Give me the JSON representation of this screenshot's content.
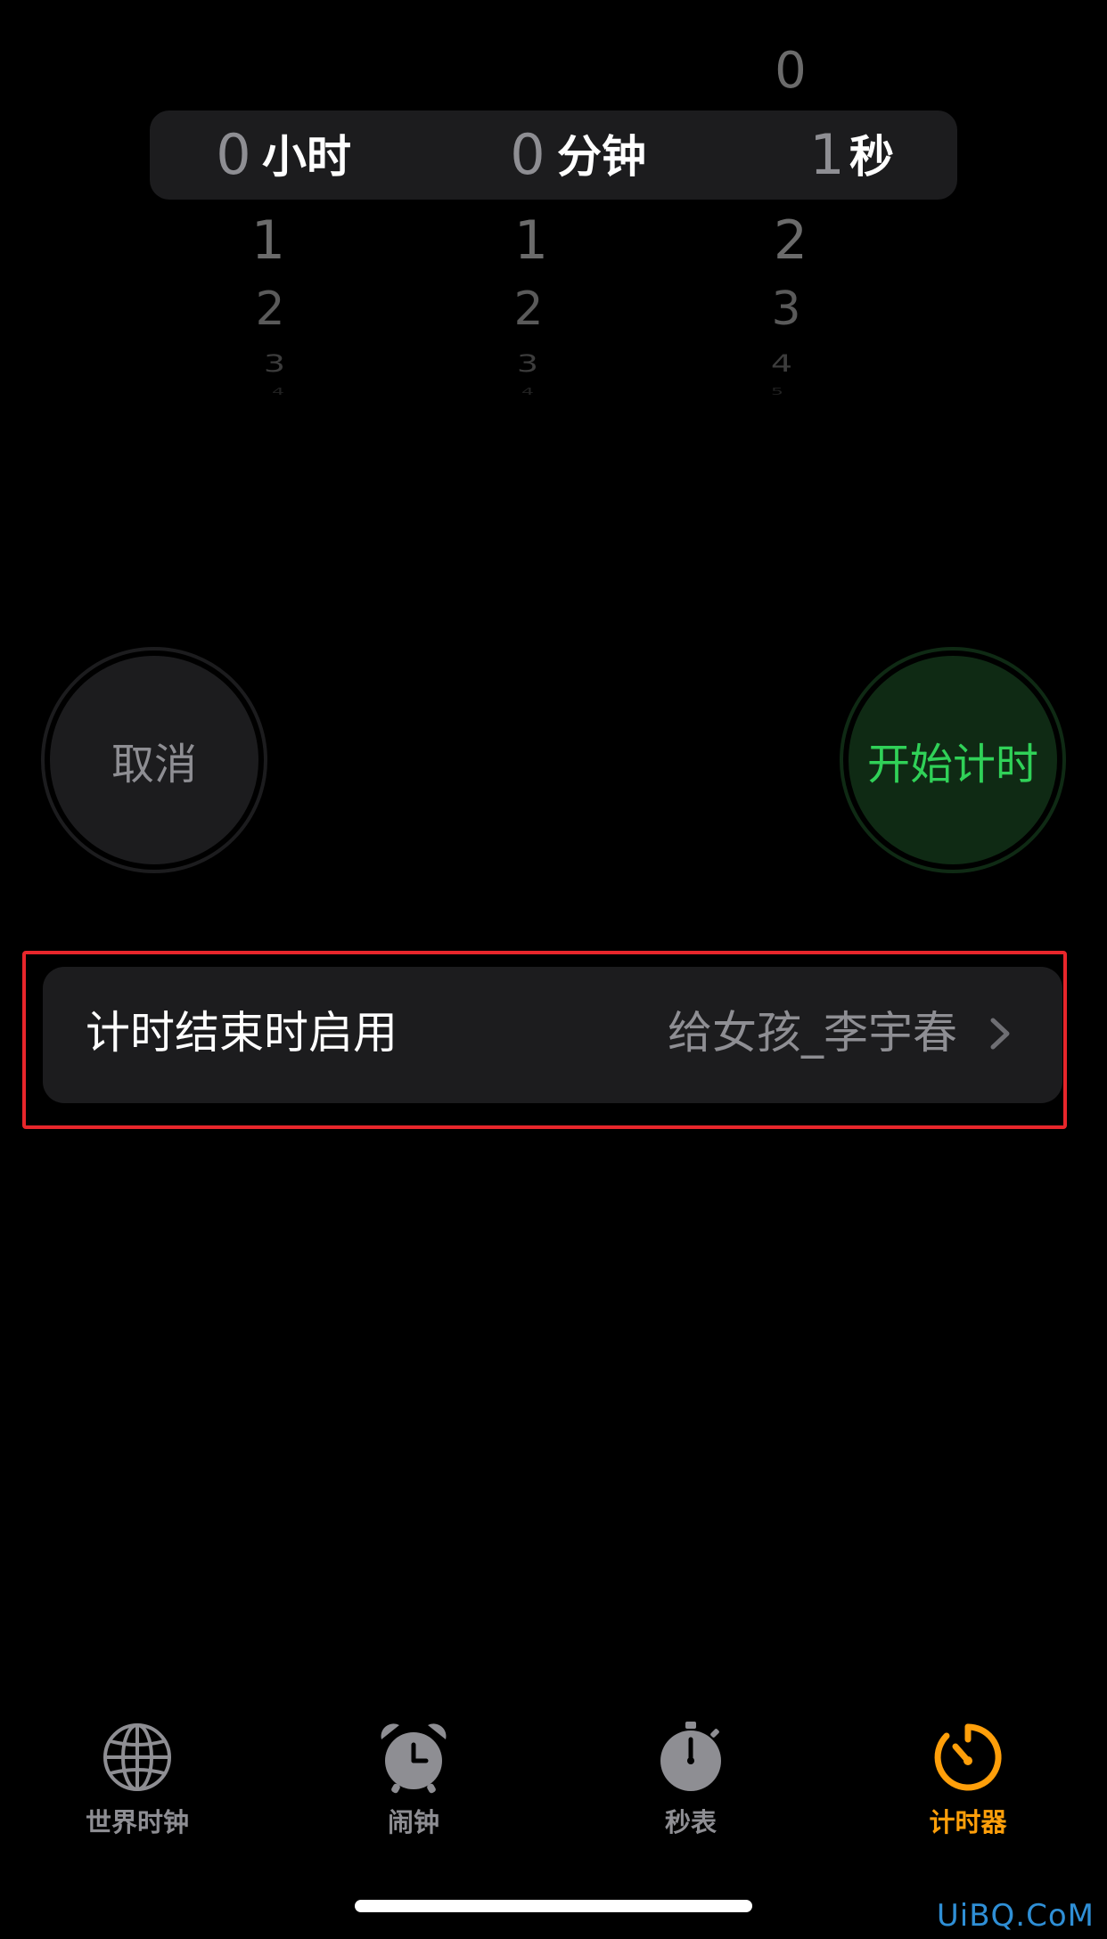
{
  "picker": {
    "hours": {
      "above": "",
      "selected": "0",
      "unit": "小时",
      "below": [
        "1",
        "2",
        "3",
        "4"
      ]
    },
    "minutes": {
      "above": "",
      "selected": "0",
      "unit": "分钟",
      "below": [
        "1",
        "2",
        "3",
        "4"
      ]
    },
    "seconds": {
      "above": "0",
      "selected": "1",
      "unit": "秒",
      "below": [
        "2",
        "3",
        "4",
        "5"
      ]
    }
  },
  "buttons": {
    "cancel_label": "取消",
    "start_label": "开始计时"
  },
  "when_timer_ends": {
    "label": "计时结束时启用",
    "value": "给女孩_李宇春"
  },
  "tabs": [
    {
      "label": "世界时钟",
      "icon": "globe-icon",
      "active": false
    },
    {
      "label": "闹钟",
      "icon": "alarm-clock-icon",
      "active": false
    },
    {
      "label": "秒表",
      "icon": "stopwatch-icon",
      "active": false
    },
    {
      "label": "计时器",
      "icon": "timer-icon",
      "active": true
    }
  ],
  "colors": {
    "background": "#000000",
    "accent_active_tab": "#ff9f0a",
    "start_green": "#30d158",
    "highlight_frame": "#e8262b"
  },
  "watermark": "UiBQ.CoM"
}
